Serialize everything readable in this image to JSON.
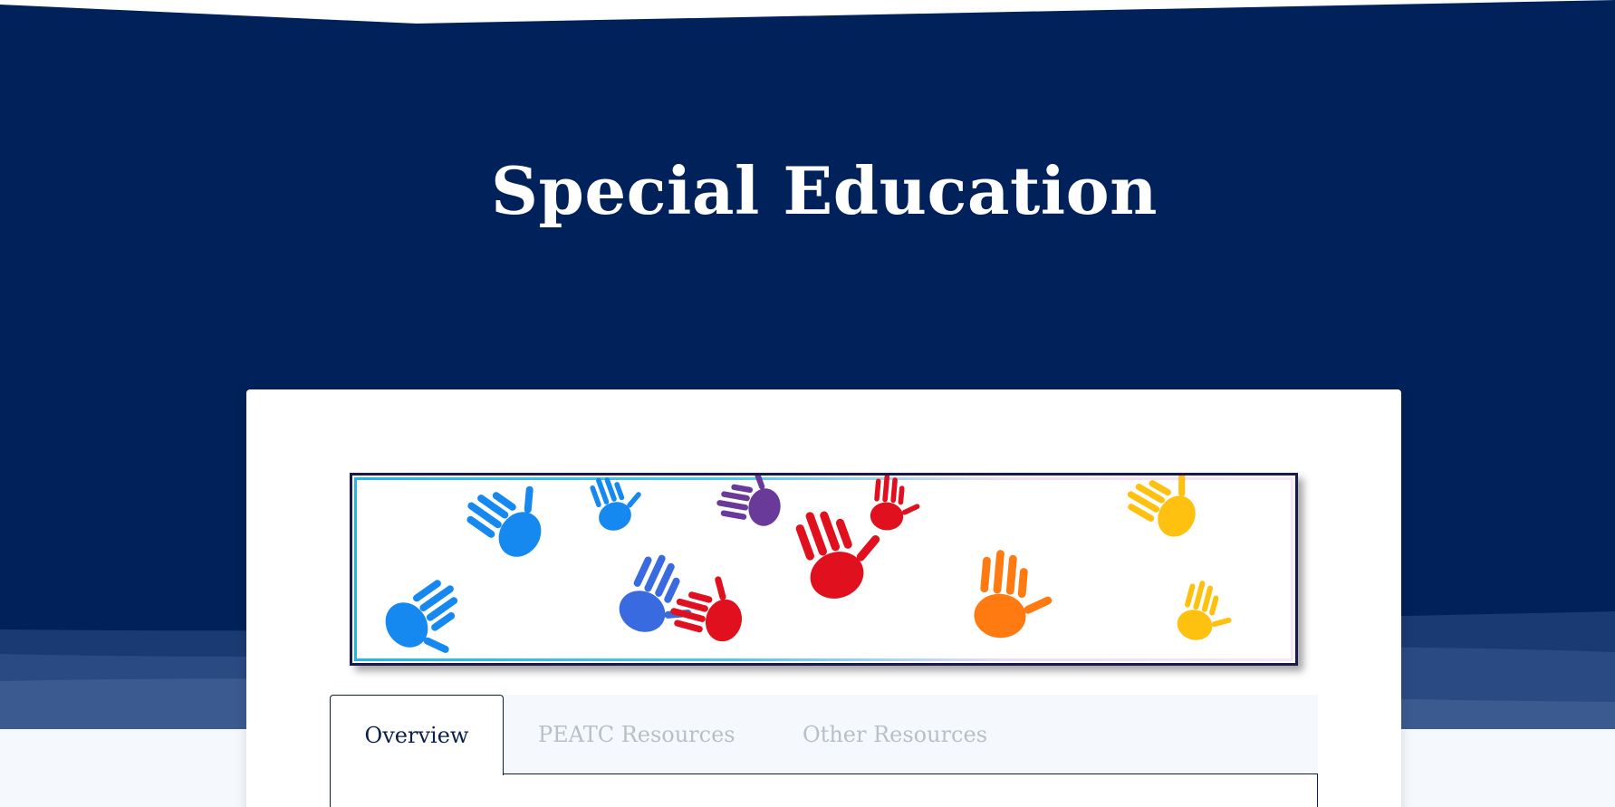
{
  "hero": {
    "title": "Special Education",
    "background_color": "#00215a"
  },
  "banner": {
    "image_name": "colorful-handprints-banner"
  },
  "tabs": [
    {
      "label": "Overview",
      "active": true
    },
    {
      "label": "PEATC Resources",
      "active": false
    },
    {
      "label": "Other Resources",
      "active": false
    }
  ],
  "colors": {
    "navy": "#00215a",
    "tab_active_text": "#0a1f4a",
    "tab_inactive_text": "#b9bfc9",
    "page_background": "#f5f8fc"
  }
}
